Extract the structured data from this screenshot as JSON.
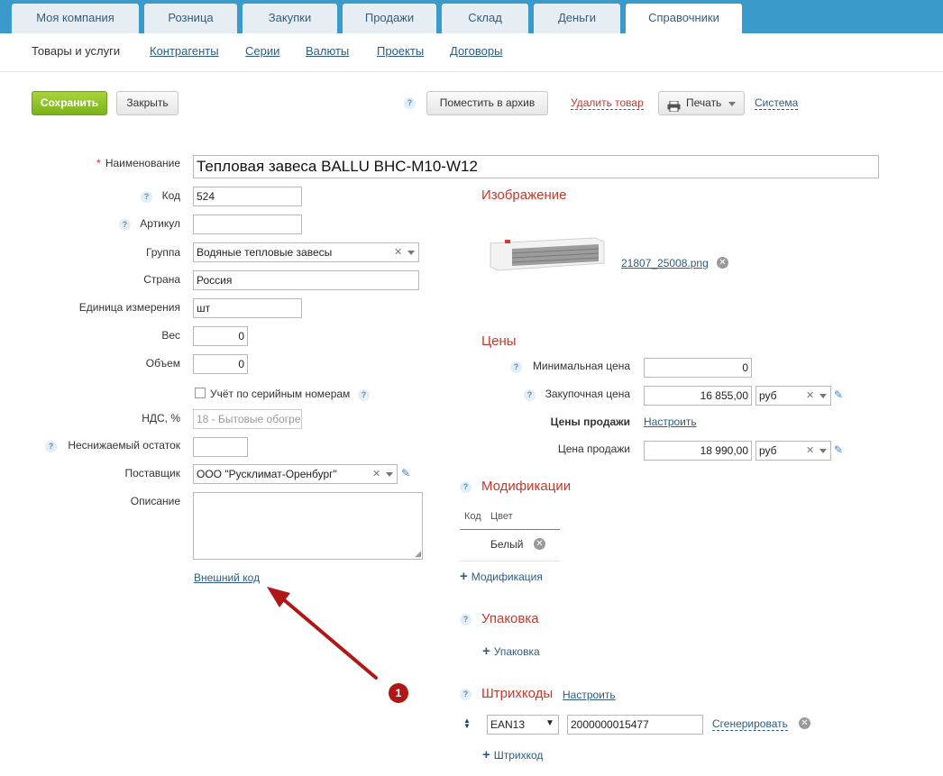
{
  "tabs": [
    {
      "label": "Моя компания"
    },
    {
      "label": "Розница"
    },
    {
      "label": "Закупки"
    },
    {
      "label": "Продажи"
    },
    {
      "label": "Склад"
    },
    {
      "label": "Деньги"
    },
    {
      "label": "Справочники"
    }
  ],
  "subnav": [
    {
      "label": "Товары и услуги"
    },
    {
      "label": "Контрагенты"
    },
    {
      "label": "Серии"
    },
    {
      "label": "Валюты"
    },
    {
      "label": "Проекты"
    },
    {
      "label": "Договоры"
    }
  ],
  "toolbar": {
    "save": "Сохранить",
    "close": "Закрыть",
    "help": "?",
    "archive": "Поместить в архив",
    "delete": "Удалить товар",
    "print": "Печать",
    "system": "Система"
  },
  "form": {
    "name_required_mark": "*",
    "name_label": "Наименование",
    "name_value": "Тепловая завеса BALLU BHC-M10-W12",
    "code_label": "Код",
    "code_value": "524",
    "article_label": "Артикул",
    "article_value": "",
    "group_label": "Группа",
    "group_value": "Водяные тепловые завесы",
    "country_label": "Страна",
    "country_value": "Россия",
    "unit_label": "Единица измерения",
    "unit_value": "шт",
    "weight_label": "Вес",
    "weight_value": "0",
    "volume_label": "Объем",
    "volume_value": "0",
    "serial_label": "Учёт по серийным номерам",
    "vat_label": "НДС, %",
    "vat_value": "18 - Бытовые обогре",
    "min_stock_label": "Неснижаемый остаток",
    "min_stock_value": "",
    "supplier_label": "Поставщик",
    "supplier_value": "ООО \"Русклимат-Оренбург\"",
    "description_label": "Описание",
    "external_code": "Внешний код"
  },
  "image_section": {
    "title": "Изображение",
    "filename": "21807_25008.png"
  },
  "prices": {
    "title": "Цены",
    "min_price_label": "Минимальная цена",
    "min_price_value": "0",
    "purchase_label": "Закупочная цена",
    "purchase_value": "16 855,00",
    "purchase_currency": "руб",
    "sale_prices_label": "Цены продажи",
    "configure": "Настроить",
    "sale_label": "Цена продажи",
    "sale_value": "18 990,00",
    "sale_currency": "руб"
  },
  "modifications": {
    "title": "Модификации",
    "col_code": "Код",
    "col_color": "Цвет",
    "row_color": "Белый",
    "add": "Модификация"
  },
  "packaging": {
    "title": "Упаковка",
    "add": "Упаковка"
  },
  "barcodes": {
    "title": "Штрихкоды",
    "configure": "Настроить",
    "type": "EAN13",
    "value": "2000000015477",
    "generate": "Сгенерировать",
    "add": "Штрихкод"
  },
  "annotation": {
    "number": "1"
  },
  "colors": {
    "topbar": "#3a9ac9",
    "accent_red": "#c0392b",
    "link": "#2b5c85",
    "save_green": "#8cc122",
    "annotation_arrow": "#b01818"
  }
}
